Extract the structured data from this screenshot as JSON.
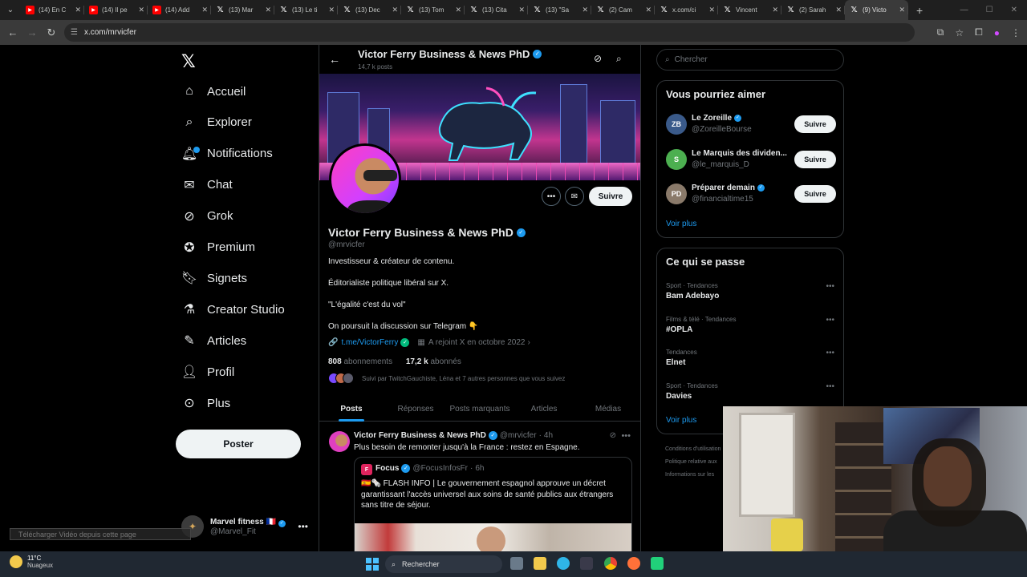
{
  "browser": {
    "tabs": [
      {
        "title": "(14) En C",
        "fav": "yt"
      },
      {
        "title": "(14) Il pe",
        "fav": "yt"
      },
      {
        "title": "(14) Add",
        "fav": "yt"
      },
      {
        "title": "(13) Mar",
        "fav": "x"
      },
      {
        "title": "(13) Le ti",
        "fav": "x"
      },
      {
        "title": "(13) Dec",
        "fav": "x"
      },
      {
        "title": "(13) Tom",
        "fav": "x"
      },
      {
        "title": "(13) Cita",
        "fav": "x"
      },
      {
        "title": "(13) \"Sa",
        "fav": "x"
      },
      {
        "title": "(2) Cam",
        "fav": "x"
      },
      {
        "title": "x.com/ci",
        "fav": "x"
      },
      {
        "title": "Vincent",
        "fav": "x"
      },
      {
        "title": "(2) Sarah",
        "fav": "x"
      },
      {
        "title": "(9) Victo",
        "fav": "x",
        "active": true
      }
    ],
    "url": "x.com/mrvicfer"
  },
  "nav": {
    "items": [
      {
        "label": "Accueil",
        "icon": "home-icon"
      },
      {
        "label": "Explorer",
        "icon": "search-icon"
      },
      {
        "label": "Notifications",
        "icon": "bell-icon"
      },
      {
        "label": "Chat",
        "icon": "mail-icon"
      },
      {
        "label": "Grok",
        "icon": "grok-icon"
      },
      {
        "label": "Premium",
        "icon": "premium-icon"
      },
      {
        "label": "Signets",
        "icon": "bookmark-icon"
      },
      {
        "label": "Creator Studio",
        "icon": "flask-icon"
      },
      {
        "label": "Articles",
        "icon": "article-icon"
      },
      {
        "label": "Profil",
        "icon": "person-icon"
      },
      {
        "label": "Plus",
        "icon": "more-circle-icon"
      }
    ],
    "post_label": "Poster",
    "account": {
      "name": "Marvel fitness",
      "flag": "🇫🇷",
      "handle": "@Marvel_Fit"
    },
    "download_overlay": "Télécharger Vidéo depuis cette page"
  },
  "profile": {
    "header_name": "Victor Ferry Business & News PhD",
    "post_count": "14,7 k posts",
    "name": "Victor Ferry Business & News PhD",
    "handle": "@mrvicfer",
    "follow_label": "Suivre",
    "bio": [
      "Investisseur & créateur de contenu.",
      "Éditorialiste politique libéral sur X.",
      "\"L'égalité c'est du vol\"",
      "On poursuit la discussion sur Telegram 👇"
    ],
    "link": "t.me/VictorFerry",
    "joined": "A rejoint X en octobre 2022",
    "following_count": "808",
    "following_label": "abonnements",
    "followers_count": "17,2 k",
    "followers_label": "abonnés",
    "followed_by": "Suivi par TwitchGauchiste, Léna et 7 autres personnes que vous suivez",
    "tabs": [
      "Posts",
      "Réponses",
      "Posts marquants",
      "Articles",
      "Médias"
    ]
  },
  "tweet": {
    "author": "Victor Ferry Business & News PhD",
    "handle": "@mrvicfer",
    "time": "4h",
    "text": "Plus besoin de remonter jusqu'à la France : restez en Espagne.",
    "quote": {
      "author": "Focus",
      "handle": "@FocusInfosFr",
      "time": "6h",
      "text": "🇪🇸🗞️ FLASH INFO | Le gouvernement espagnol approuve un décret garantissant l'accès universel aux soins de santé publics aux étrangers sans titre de séjour."
    }
  },
  "right": {
    "search_placeholder": "Chercher",
    "suggestions_title": "Vous pourriez aimer",
    "suggestions": [
      {
        "name": "Le Zoreille",
        "handle": "@ZoreilleBourse",
        "avatar_text": "ZB",
        "color": "#3a5a8a",
        "verified": true
      },
      {
        "name": "Le Marquis des dividen...",
        "handle": "@le_marquis_D",
        "avatar_text": "S",
        "color": "#4caf50",
        "verified": false
      },
      {
        "name": "Préparer demain",
        "handle": "@financialtime15",
        "avatar_text": "PD",
        "color": "#8a7a6a",
        "verified": true
      }
    ],
    "follow_label": "Suivre",
    "see_more": "Voir plus",
    "trends_title": "Ce qui se passe",
    "trends": [
      {
        "category": "Sport · Tendances",
        "name": "Bam Adebayo"
      },
      {
        "category": "Films & télé · Tendances",
        "name": "#OPLA"
      },
      {
        "category": "Tendances",
        "name": "Elnet"
      },
      {
        "category": "Sport · Tendances",
        "name": "Davies"
      }
    ],
    "footer": [
      "Conditions d'utilisation",
      "Politique relative aux",
      "Informations sur les"
    ]
  },
  "taskbar": {
    "temp": "11°C",
    "weather": "Nuageux",
    "search": "Rechercher"
  }
}
